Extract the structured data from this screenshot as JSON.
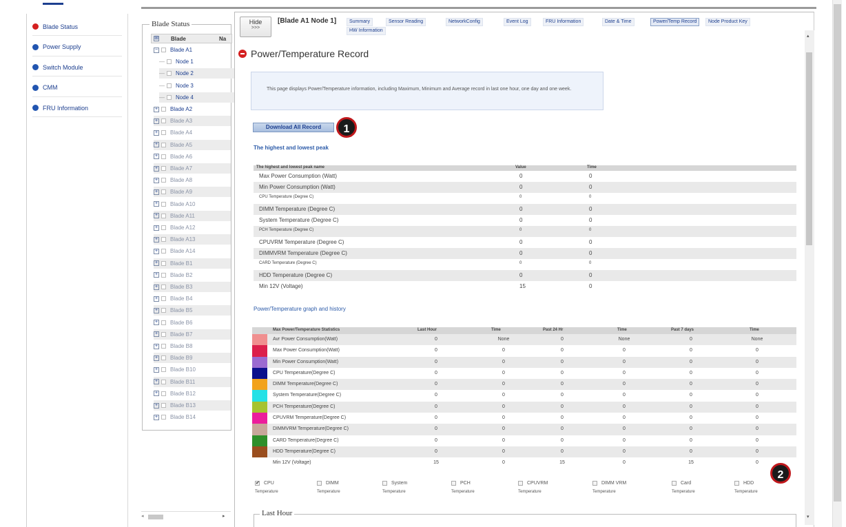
{
  "leftnav": {
    "items": [
      {
        "label": "Blade Status",
        "icon": "red-dot-icon",
        "color": "#d42020"
      },
      {
        "label": "Power Supply",
        "icon": "blue-dot-icon",
        "color": "#2255b0"
      },
      {
        "label": "Switch Module",
        "icon": "blue-dot-icon",
        "color": "#2255b0"
      },
      {
        "label": "CMM",
        "icon": "blue-dot-icon",
        "color": "#2255b0"
      },
      {
        "label": "FRU Information",
        "icon": "blue-dot-icon",
        "color": "#2255b0"
      }
    ]
  },
  "bladepanel": {
    "title": "Blade Status",
    "col_blade": "Blade",
    "col_na": "Na",
    "rows": [
      {
        "label": "Blade A1",
        "toggle": "⊟",
        "active": true,
        "shaded": false
      },
      {
        "label": "Node 1",
        "toggle": "",
        "active": true,
        "shaded": false
      },
      {
        "label": "Node 2",
        "toggle": "",
        "active": true,
        "shaded": true
      },
      {
        "label": "Node 3",
        "toggle": "",
        "active": true,
        "shaded": false
      },
      {
        "label": "Node 4",
        "toggle": "",
        "active": true,
        "shaded": true
      },
      {
        "label": "Blade A2",
        "toggle": "⊞",
        "active": true,
        "shaded": false
      },
      {
        "label": "Blade A3",
        "toggle": "⊞",
        "active": false,
        "shaded": true
      },
      {
        "label": "Blade A4",
        "toggle": "⊞",
        "active": false,
        "shaded": false
      },
      {
        "label": "Blade A5",
        "toggle": "⊞",
        "active": false,
        "shaded": true
      },
      {
        "label": "Blade A6",
        "toggle": "⊞",
        "active": false,
        "shaded": false
      },
      {
        "label": "Blade A7",
        "toggle": "⊞",
        "active": false,
        "shaded": true
      },
      {
        "label": "Blade A8",
        "toggle": "⊞",
        "active": false,
        "shaded": false
      },
      {
        "label": "Blade A9",
        "toggle": "⊞",
        "active": false,
        "shaded": true
      },
      {
        "label": "Blade A10",
        "toggle": "⊞",
        "active": false,
        "shaded": false
      },
      {
        "label": "Blade A11",
        "toggle": "⊞",
        "active": false,
        "shaded": true
      },
      {
        "label": "Blade A12",
        "toggle": "⊞",
        "active": false,
        "shaded": false
      },
      {
        "label": "Blade A13",
        "toggle": "⊞",
        "active": false,
        "shaded": true
      },
      {
        "label": "Blade A14",
        "toggle": "⊞",
        "active": false,
        "shaded": false
      },
      {
        "label": "Blade B1",
        "toggle": "⊞",
        "active": false,
        "shaded": true
      },
      {
        "label": "Blade B2",
        "toggle": "⊞",
        "active": false,
        "shaded": false
      },
      {
        "label": "Blade B3",
        "toggle": "⊞",
        "active": false,
        "shaded": true
      },
      {
        "label": "Blade B4",
        "toggle": "⊞",
        "active": false,
        "shaded": false
      },
      {
        "label": "Blade B5",
        "toggle": "⊞",
        "active": false,
        "shaded": true
      },
      {
        "label": "Blade B6",
        "toggle": "⊞",
        "active": false,
        "shaded": false
      },
      {
        "label": "Blade B7",
        "toggle": "⊞",
        "active": false,
        "shaded": true
      },
      {
        "label": "Blade B8",
        "toggle": "⊞",
        "active": false,
        "shaded": false
      },
      {
        "label": "Blade B9",
        "toggle": "⊞",
        "active": false,
        "shaded": true
      },
      {
        "label": "Blade B10",
        "toggle": "⊞",
        "active": false,
        "shaded": false
      },
      {
        "label": "Blade B11",
        "toggle": "⊞",
        "active": false,
        "shaded": true
      },
      {
        "label": "Blade B12",
        "toggle": "⊞",
        "active": false,
        "shaded": false
      },
      {
        "label": "Blade B13",
        "toggle": "⊞",
        "active": false,
        "shaded": true
      },
      {
        "label": "Blade B14",
        "toggle": "⊞",
        "active": false,
        "shaded": false
      }
    ]
  },
  "tabbar": {
    "hide_label": "Hide",
    "hide_arrows": ">>>",
    "node_title": "[Blade A1 Node 1]",
    "tabs": [
      {
        "label": "Summary",
        "selected": false
      },
      {
        "label": "Sensor Reading",
        "selected": false
      },
      {
        "label": "NetworkConfig",
        "selected": false
      },
      {
        "label": "Event Log",
        "selected": false
      },
      {
        "label": "FRU Information",
        "selected": false
      },
      {
        "label": "Date & Time",
        "selected": false
      },
      {
        "label": "Power/Temp Record",
        "selected": true
      },
      {
        "label": "Node Product Key",
        "selected": false
      },
      {
        "label": "HW Information",
        "selected": false
      }
    ]
  },
  "page": {
    "title": "Power/Temperature Record",
    "description": "This page displays Power/Temperature information, including Maximum, Minimum and Average record in last one hour, one day and one week.",
    "download_label": "Download All Record",
    "marker1": "1",
    "marker2": "2",
    "peak_heading": "The highest and lowest peak",
    "graph_heading": "Power/Temperature graph and history",
    "last_hour_legend": "Last Hour"
  },
  "peak_table": {
    "col_name": "The highest and lowest peak name",
    "col_value": "Value",
    "col_time": "Time",
    "rows": [
      {
        "name": "Max Power Consumption (Watt)",
        "value": "0",
        "time": "0"
      },
      {
        "name": "Min Power Consumption (Watt)",
        "value": "0",
        "time": "0"
      },
      {
        "name": "CPU Temperature (Degree C)",
        "value": "0",
        "time": "0"
      },
      {
        "name": "DIMM Temperature (Degree C)",
        "value": "0",
        "time": "0"
      },
      {
        "name": "System Temperature (Degree C)",
        "value": "0",
        "time": "0"
      },
      {
        "name": "PCH Temperature (Degree C)",
        "value": "0",
        "time": "0"
      },
      {
        "name": "CPUVRM Temperature (Degree C)",
        "value": "0",
        "time": "0"
      },
      {
        "name": "DIMMVRM Temperature (Degree C)",
        "value": "0",
        "time": "0"
      },
      {
        "name": "CARD Temperature (Degree C)",
        "value": "0",
        "time": "0"
      },
      {
        "name": "HDD Temperature (Degree C)",
        "value": "0",
        "time": "0"
      },
      {
        "name": "Min 12V (Voltage)",
        "value": "15",
        "time": "0"
      }
    ]
  },
  "graph_table": {
    "col_name": "Max Power/Temperature Statistics",
    "col_last_hour": "Last Hour",
    "col_time1": "Time",
    "col_past24": "Past 24 Hr",
    "col_time2": "Time",
    "col_past7": "Past 7 days",
    "col_time3": "Time",
    "rows": [
      {
        "color": "#f08f8f",
        "name": "Avr Power Consumption(Watt)",
        "lh": "0",
        "t1": "None",
        "p24": "0",
        "t2": "None",
        "p7": "0",
        "t3": "None"
      },
      {
        "color": "#dc1f4b",
        "name": "Max Power Consumption(Watt)",
        "lh": "0",
        "t1": "0",
        "p24": "0",
        "t2": "0",
        "p7": "0",
        "t3": "0"
      },
      {
        "color": "#9b6ad1",
        "name": "Min Power Consumption(Watt)",
        "lh": "0",
        "t1": "0",
        "p24": "0",
        "t2": "0",
        "p7": "0",
        "t3": "0"
      },
      {
        "color": "#0b0f8c",
        "name": "CPU Temperature(Degree C)",
        "lh": "0",
        "t1": "0",
        "p24": "0",
        "t2": "0",
        "p7": "0",
        "t3": "0"
      },
      {
        "color": "#f2a21b",
        "name": "DIMM Temperature(Degree C)",
        "lh": "0",
        "t1": "0",
        "p24": "0",
        "t2": "0",
        "p7": "0",
        "t3": "0"
      },
      {
        "color": "#25e1e6",
        "name": "System Temperature(Degree C)",
        "lh": "0",
        "t1": "0",
        "p24": "0",
        "t2": "0",
        "p7": "0",
        "t3": "0"
      },
      {
        "color": "#a6c330",
        "name": "PCH Temperature(Degree C)",
        "lh": "0",
        "t1": "0",
        "p24": "0",
        "t2": "0",
        "p7": "0",
        "t3": "0"
      },
      {
        "color": "#ec1d9c",
        "name": "CPUVRM Temperature(Degree C)",
        "lh": "0",
        "t1": "0",
        "p24": "0",
        "t2": "0",
        "p7": "0",
        "t3": "0"
      },
      {
        "color": "#c8a79a",
        "name": "DIMMVRM Temperature(Degree C)",
        "lh": "0",
        "t1": "0",
        "p24": "0",
        "t2": "0",
        "p7": "0",
        "t3": "0"
      },
      {
        "color": "#2f8f2a",
        "name": "CARD Temperature(Degree C)",
        "lh": "0",
        "t1": "0",
        "p24": "0",
        "t2": "0",
        "p7": "0",
        "t3": "0"
      },
      {
        "color": "#9a4e1e",
        "name": "HDD Temperature(Degree C)",
        "lh": "0",
        "t1": "0",
        "p24": "0",
        "t2": "0",
        "p7": "0",
        "t3": "0"
      },
      {
        "color": "",
        "name": "Min 12V (Voltage)",
        "lh": "15",
        "t1": "0",
        "p24": "15",
        "t2": "0",
        "p7": "15",
        "t3": "0"
      }
    ]
  },
  "checkboxes": [
    {
      "label": "CPU",
      "sub": "Temperature",
      "checked": true
    },
    {
      "label": "DIMM",
      "sub": "Temperature",
      "checked": false
    },
    {
      "label": "System",
      "sub": "Temperature",
      "checked": false
    },
    {
      "label": "PCH",
      "sub": "Temperature",
      "checked": false
    },
    {
      "label": "CPUVRM",
      "sub": "Temperature",
      "checked": false
    },
    {
      "label": "DIMM VRM",
      "sub": "Temperature",
      "checked": false
    },
    {
      "label": "Card",
      "sub": "Temperature",
      "checked": false
    },
    {
      "label": "HDD",
      "sub": "Temperature",
      "checked": false
    }
  ]
}
